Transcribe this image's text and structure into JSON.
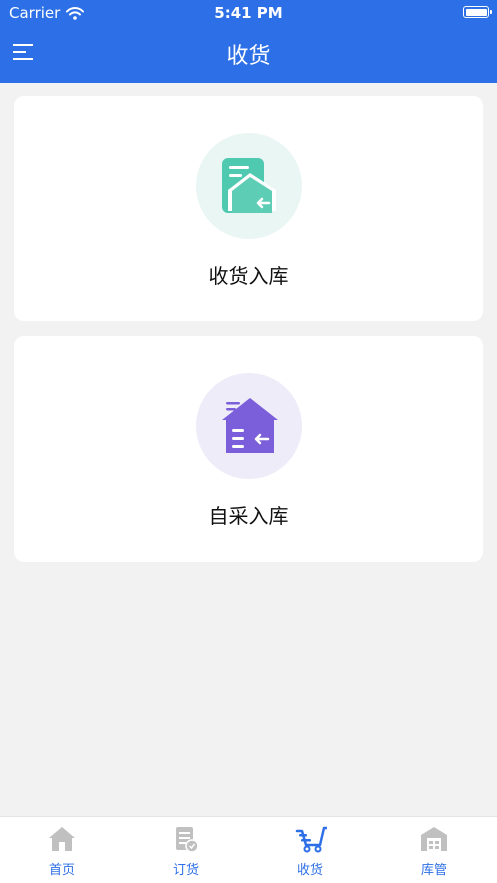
{
  "status_bar": {
    "carrier": "Carrier",
    "time": "5:41 PM"
  },
  "header": {
    "title": "收货"
  },
  "cards": [
    {
      "label": "收货入库",
      "icon": "receive-storage-icon",
      "color": "#4fc9b0"
    },
    {
      "label": "自采入库",
      "icon": "self-purchase-storage-icon",
      "color": "#7b5ed9"
    }
  ],
  "tabbar": {
    "items": [
      {
        "label": "首页",
        "icon": "home-icon"
      },
      {
        "label": "订货",
        "icon": "order-icon"
      },
      {
        "label": "收货",
        "icon": "cart-icon",
        "active": true
      },
      {
        "label": "库管",
        "icon": "warehouse-icon"
      }
    ],
    "active_color": "#2d6fe6",
    "inactive_icon_color": "#c0c0c0"
  }
}
